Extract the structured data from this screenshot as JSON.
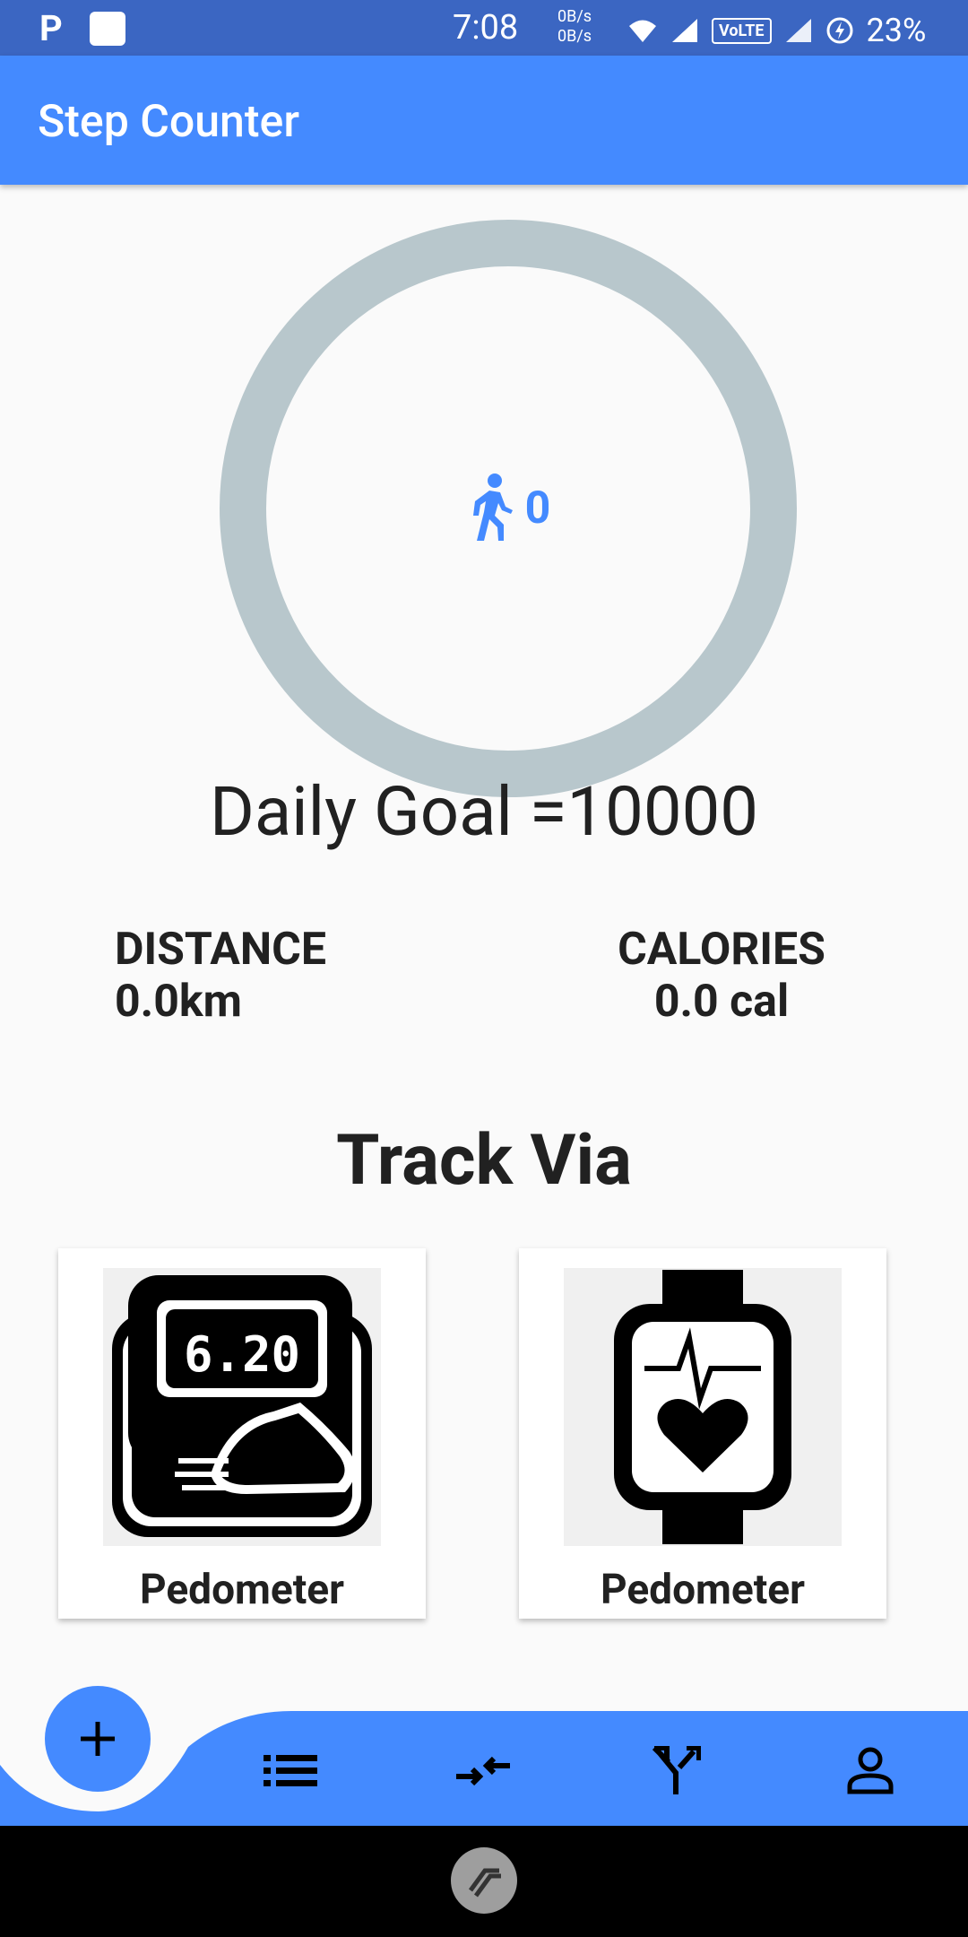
{
  "status_bar": {
    "left_icons": [
      "P",
      "notification-square"
    ],
    "time": "7:08",
    "net_up": "0B/s",
    "net_down": "0B/s",
    "volte": "VoLTE",
    "battery": "23%"
  },
  "app_bar": {
    "title": "Step Counter"
  },
  "steps": {
    "count": "0",
    "icon": "walk-icon"
  },
  "goal": {
    "text": "Daily Goal =10000"
  },
  "stats": {
    "distance_label": "DISTANCE",
    "distance_value": "0.0km",
    "calories_label": "CALORIES",
    "calories_value": "0.0 cal"
  },
  "track": {
    "title": "Track Via",
    "cards": [
      {
        "label": "Pedometer",
        "display_value": "6.20"
      },
      {
        "label": "Pedometer"
      }
    ]
  },
  "bottom_nav": {
    "items": [
      "add",
      "list",
      "compare",
      "split",
      "person"
    ]
  },
  "colors": {
    "primary": "#448aff",
    "status": "#3b66c2",
    "ring": "#b8c7cc"
  }
}
